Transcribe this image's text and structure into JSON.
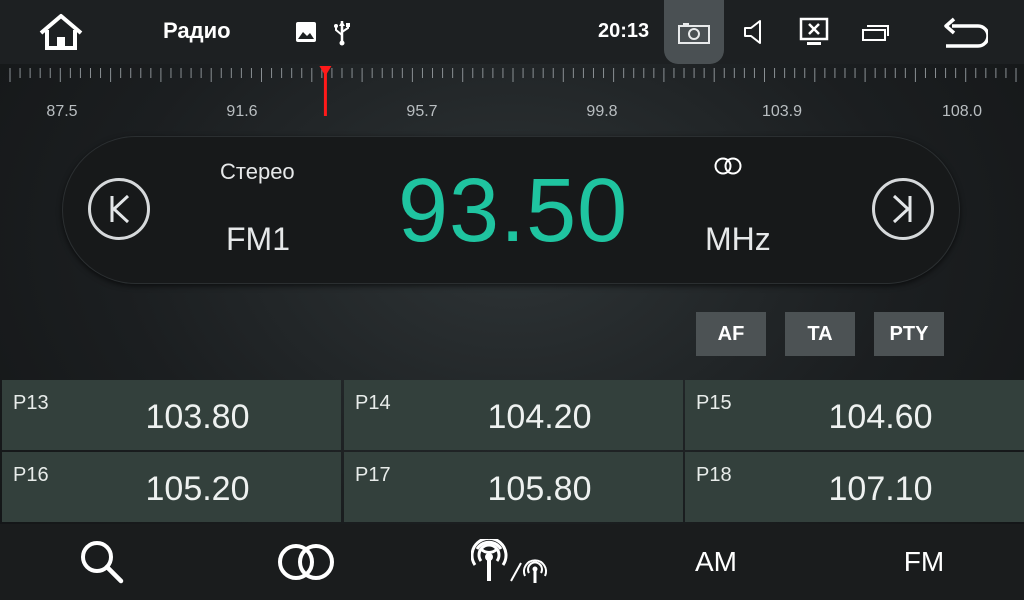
{
  "status_bar": {
    "title": "Радио",
    "time": "20:13",
    "icons": [
      "home-icon",
      "image-icon",
      "usb-icon",
      "screenshot-icon",
      "volume-icon",
      "close-screen-icon",
      "window-icon",
      "back-icon"
    ]
  },
  "tuner": {
    "scale_labels": [
      "87.5",
      "91.6",
      "95.7",
      "99.8",
      "103.9",
      "108.0"
    ],
    "range_mhz": [
      87.5,
      108.0
    ],
    "needle_mhz": 93.5,
    "indicator_color": "#ff1a1a"
  },
  "display": {
    "stereo_label": "Стерео",
    "band": "FM1",
    "frequency": "93.50",
    "unit": "MHz",
    "frequency_color": "#1fc4a0"
  },
  "options": {
    "af": "AF",
    "ta": "TA",
    "pty": "PTY"
  },
  "presets": [
    {
      "num": "P13",
      "freq": "103.80"
    },
    {
      "num": "P14",
      "freq": "104.20"
    },
    {
      "num": "P15",
      "freq": "104.60"
    },
    {
      "num": "P16",
      "freq": "105.20"
    },
    {
      "num": "P17",
      "freq": "105.80"
    },
    {
      "num": "P18",
      "freq": "107.10"
    }
  ],
  "bottom_bar": {
    "search_icon": "search-icon",
    "stereo_icon": "stereo-icon",
    "local_distance_icon": "antenna-icon",
    "am_label": "AM",
    "fm_label": "FM"
  }
}
